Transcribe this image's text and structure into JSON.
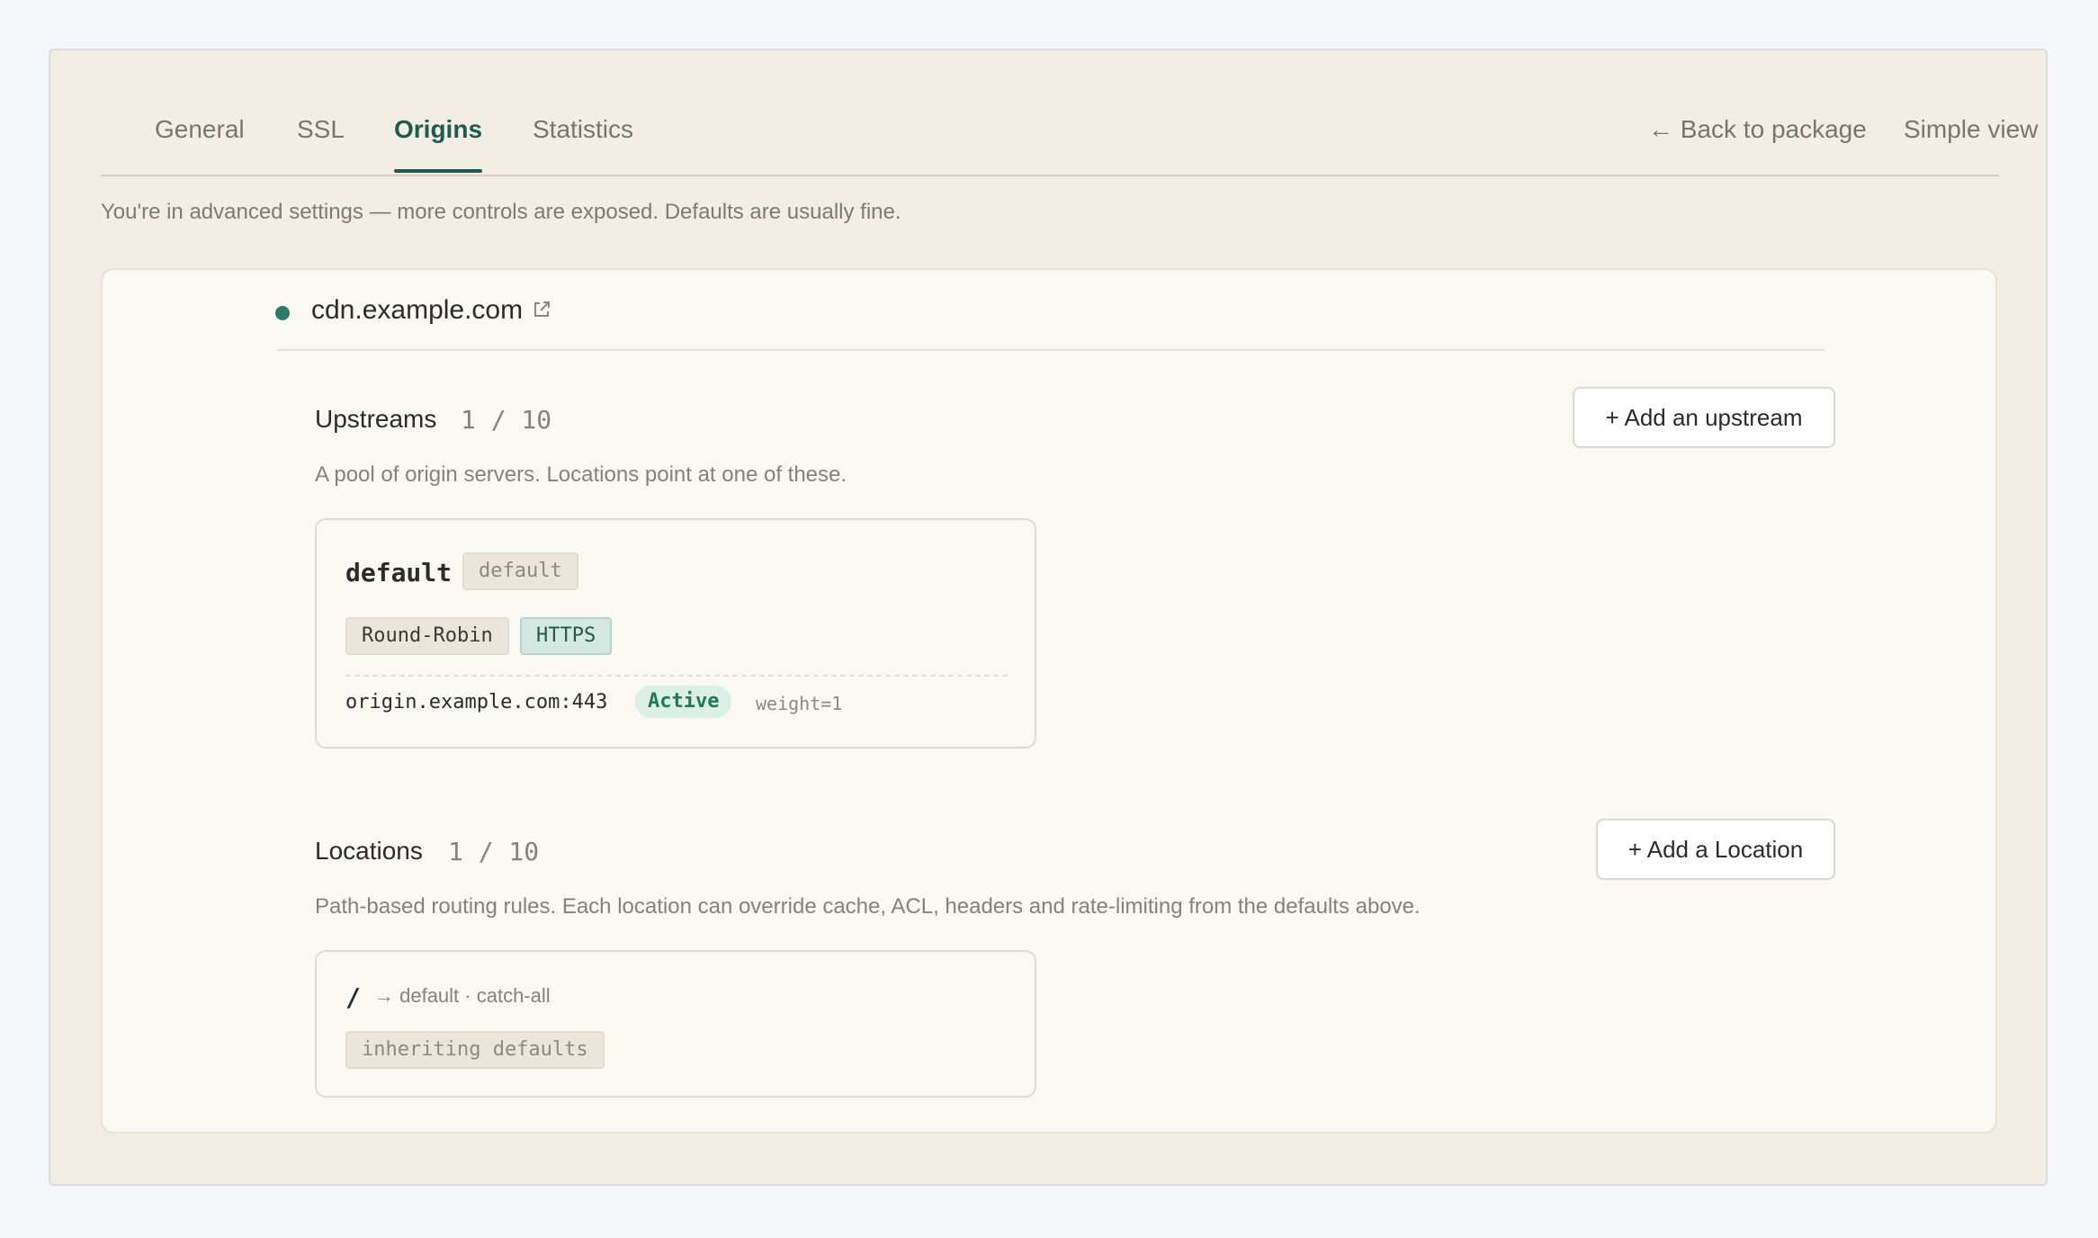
{
  "tabs": [
    {
      "label": "General",
      "active": false
    },
    {
      "label": "SSL",
      "active": false
    },
    {
      "label": "Origins",
      "active": true
    },
    {
      "label": "Statistics",
      "active": false
    }
  ],
  "header_links": {
    "back": "← Back to package",
    "simple_view": "Simple view"
  },
  "notice": "You're in advanced settings — more controls are exposed. Defaults are usually fine.",
  "host": {
    "name": "cdn.example.com",
    "status_color": "#2e7b6c",
    "icon": "external-link-icon"
  },
  "upstreams": {
    "title": "Upstreams",
    "count": "1 / 10",
    "add_button": "+ Add an upstream",
    "description": "A pool of origin servers. Locations point at one of these.",
    "items": [
      {
        "name": "default",
        "badge": "default",
        "tags": [
          "Round-Robin",
          "HTTPS"
        ],
        "servers": [
          {
            "address": "origin.example.com:443",
            "status": "Active",
            "weight": "weight=1"
          }
        ]
      }
    ]
  },
  "locations": {
    "title": "Locations",
    "count": "1 / 10",
    "add_button": "+ Add a Location",
    "description": "Path-based routing rules. Each location can override cache, ACL, headers and rate-limiting from the defaults above.",
    "items": [
      {
        "path": "/",
        "target": "→ default · catch-all",
        "tag": "inheriting defaults"
      }
    ]
  },
  "colors": {
    "accent": "#1f5a4f",
    "active_status": "#1f7a52",
    "panel_bg": "#f2eee4",
    "card_bg": "#faf8f2"
  }
}
